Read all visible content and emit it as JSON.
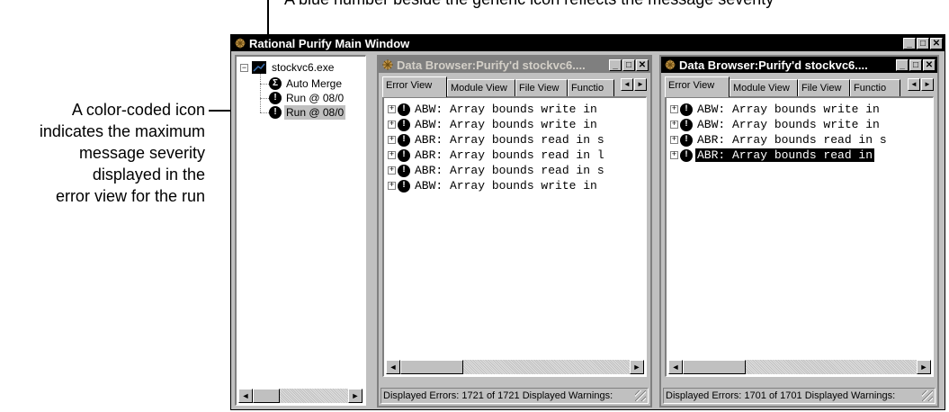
{
  "callouts": {
    "top_fragment": "A blue number beside the generic icon reflects the message severity",
    "icon_explanation": [
      "A color-coded icon",
      "indicates the maximum",
      "message severity",
      "displayed in the",
      "error view for the run"
    ]
  },
  "main_window": {
    "title": "Rational Purify Main Window",
    "controls": [
      "_",
      "□",
      "✕"
    ]
  },
  "tree": {
    "root": {
      "expander": "−",
      "label": "stockvc6.exe"
    },
    "items": [
      {
        "icon": "Σ",
        "label": "Auto Merge"
      },
      {
        "icon": "!",
        "label": "Run @ 08/0"
      },
      {
        "icon": "!",
        "label": "Run @ 08/0",
        "selected": true
      }
    ],
    "scroll_left": "◄",
    "scroll_right": "►"
  },
  "browsers": [
    {
      "title": "Data Browser:Purify'd stockvc6....",
      "active": false,
      "tabs": [
        "Error View",
        "Module View",
        "File View",
        "Functio"
      ],
      "errors": [
        "ABW: Array bounds write in",
        "ABW: Array bounds write in",
        "ABR: Array bounds read in s",
        "ABR: Array bounds read in l",
        "ABR: Array bounds read in s",
        "ABW: Array bounds write in"
      ],
      "selected_index": -1,
      "status": "Displayed Errors: 1721 of 1721   Displayed Warnings:"
    },
    {
      "title": "Data Browser:Purify'd stockvc6....",
      "active": true,
      "tabs": [
        "Error View",
        "Module View",
        "File View",
        "Functio"
      ],
      "errors": [
        "ABW: Array bounds write in",
        "ABW: Array bounds write in",
        "ABR: Array bounds read in s",
        "ABR: Array bounds read in"
      ],
      "selected_index": 3,
      "status": "Displayed Errors: 1701 of 1701   Displayed Warnings:"
    }
  ]
}
